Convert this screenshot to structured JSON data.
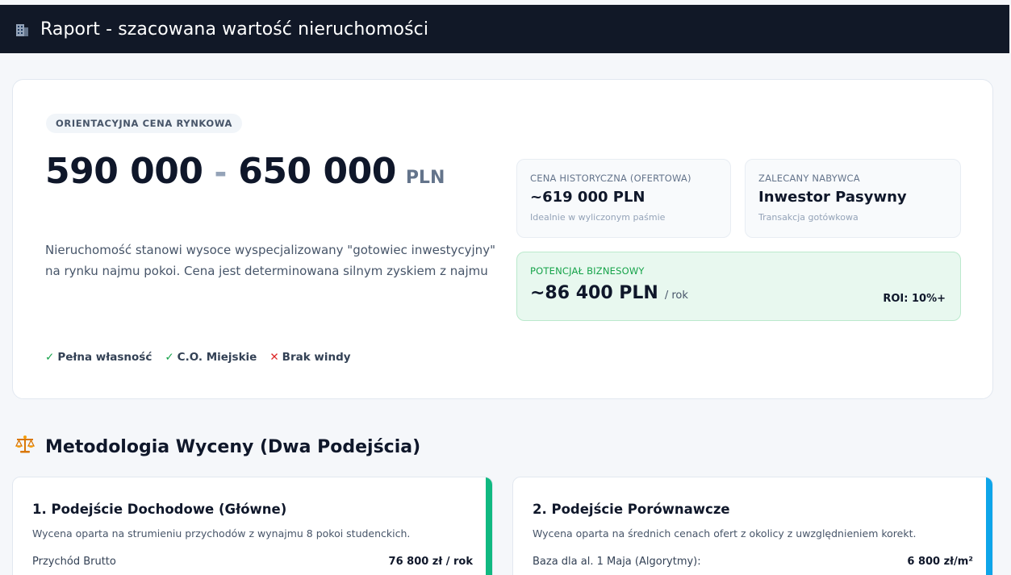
{
  "header": {
    "title": "Raport - szacowana wartość nieruchomości",
    "icon": "building-icon"
  },
  "hero": {
    "pill": "ORIENTACYJNA CENA RYNKOWA",
    "price_low": "590 000",
    "price_sep": "-",
    "price_high": "650 000",
    "currency": "PLN",
    "description": "Nieruchomość stanowi wysoce wyspecjalizowany \"gotowiec inwestycyjny\" na rynku najmu pokoi. Cena jest determinowana silnym zyskiem z najmu",
    "features": [
      {
        "mark": "✓",
        "label": "Pełna własność",
        "ok": true
      },
      {
        "mark": "✓",
        "label": "C.O. Miejskie",
        "ok": true
      },
      {
        "mark": "✕",
        "label": "Brak windy",
        "ok": false
      }
    ]
  },
  "cards": {
    "historical": {
      "label": "CENA HISTORYCZNA (OFERTOWA)",
      "value": "~619 000 PLN",
      "sub": "Idealnie w wyliczonym paśmie"
    },
    "buyer": {
      "label": "ZALECANY NABYWCA",
      "value": "Inwestor Pasywny",
      "sub": "Transakcja gotówkowa"
    },
    "business": {
      "label": "POTENCJAŁ BIZNESOWY",
      "value": "~86 400 PLN",
      "per": "/ rok",
      "roi": "ROI: 10%+"
    }
  },
  "methodology": {
    "title": "Metodologia Wyceny (Dwa Podejścia)",
    "icon": "scales-icon",
    "approaches": [
      {
        "title": "1. Podejście Dochodowe (Główne)",
        "desc": "Wycena oparta na strumieniu przychodów z wynajmu 8 pokoi studenckich.",
        "row_label": "Przychód Brutto",
        "row_value": "76 800 zł / rok",
        "accent": "#10b981"
      },
      {
        "title": "2. Podejście Porównawcze",
        "desc": "Wycena oparta na średnich cenach ofert z okolicy z uwzględnieniem korekt.",
        "row_label": "Baza dla al. 1 Maja (Algorytmy):",
        "row_value": "6 800 zł/m²",
        "accent": "#0ea5e9"
      }
    ]
  }
}
